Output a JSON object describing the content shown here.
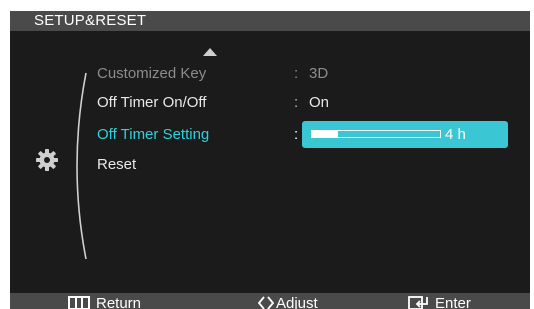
{
  "header": {
    "title": "SETUP&RESET"
  },
  "menu": {
    "items": [
      {
        "label": "Customized Key",
        "value": "3D",
        "state": "dim"
      },
      {
        "label": "Off Timer On/Off",
        "value": "On",
        "state": "normal"
      },
      {
        "label": "Off Timer Setting",
        "value": "4 h",
        "state": "active",
        "slider_fraction": 0.2
      },
      {
        "label": "Reset",
        "value": "",
        "state": "normal"
      }
    ],
    "separator": ":"
  },
  "icons": {
    "category": "gear-icon",
    "scroll_up": "up-arrow-icon",
    "return": "menu-icon",
    "adjust": "diamond-arrows-icon",
    "enter": "enter-icon"
  },
  "footer": {
    "return_label": "Return",
    "adjust_label": "Adjust",
    "enter_label": "Enter"
  },
  "colors": {
    "accent": "#3bc6d4",
    "active_text": "#2ed0e0",
    "background": "#1b1b1b",
    "bar": "#4a4a4a"
  }
}
